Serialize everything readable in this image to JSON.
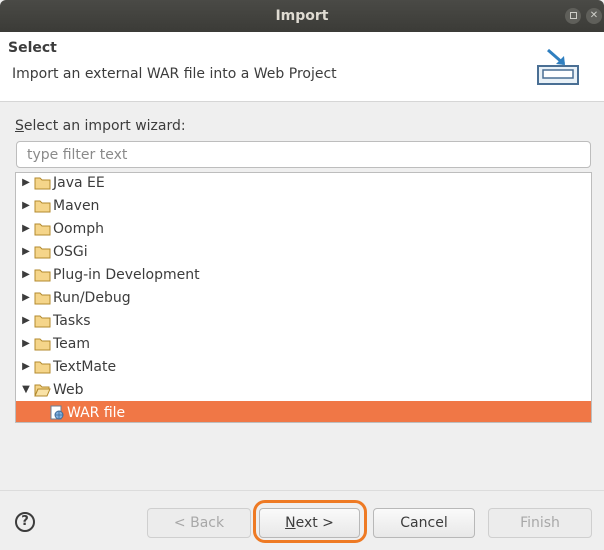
{
  "window": {
    "title": "Import"
  },
  "header": {
    "title": "Select",
    "description": "Import an external WAR file into a Web Project",
    "icon": "import-wizard-icon"
  },
  "wizard": {
    "label_prefix": "",
    "label_mnemonic": "S",
    "label_rest": "elect an import wizard:",
    "filter_placeholder": "type filter text"
  },
  "tree": {
    "items": [
      {
        "label": "Java EE",
        "expanded": false
      },
      {
        "label": "Maven",
        "expanded": false
      },
      {
        "label": "Oomph",
        "expanded": false
      },
      {
        "label": "OSGi",
        "expanded": false
      },
      {
        "label": "Plug-in Development",
        "expanded": false
      },
      {
        "label": "Run/Debug",
        "expanded": false
      },
      {
        "label": "Tasks",
        "expanded": false
      },
      {
        "label": "Team",
        "expanded": false
      },
      {
        "label": "TextMate",
        "expanded": false
      },
      {
        "label": "Web",
        "expanded": true
      }
    ],
    "child": {
      "label": "WAR file",
      "selected": true
    }
  },
  "buttons": {
    "back": "< Back",
    "next_mnemonic": "N",
    "next_rest": "ext >",
    "cancel": "Cancel",
    "finish": "Finish",
    "help": "?"
  },
  "colors": {
    "selection": "#f07746",
    "highlight_ring": "#ee7a24"
  }
}
